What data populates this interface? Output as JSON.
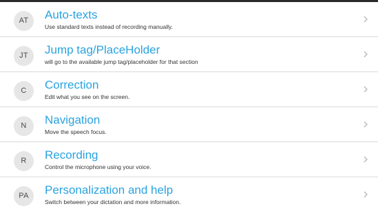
{
  "commands": {
    "items": [
      {
        "initials": "AT",
        "title": "Auto-texts",
        "subtitle": "Use standard texts instead of recording manually."
      },
      {
        "initials": "JT",
        "title": "Jump tag/PlaceHolder",
        "subtitle": "will go to the available jump tag/placeholder for that section"
      },
      {
        "initials": "C",
        "title": "Correction",
        "subtitle": "Edit what you see on the screen."
      },
      {
        "initials": "N",
        "title": "Navigation",
        "subtitle": "Move the speech focus."
      },
      {
        "initials": "R",
        "title": "Recording",
        "subtitle": "Control the microphone using your voice."
      },
      {
        "initials": "PA",
        "title": "Personalization and help",
        "subtitle": "Switch between your dictation and more information."
      }
    ]
  },
  "colors": {
    "title": "#29a3e0",
    "avatar_bg": "#e6e6e6",
    "divider": "#d9d9d9",
    "chevron": "#b5b5b5"
  },
  "icons": {
    "chevron": "chevron-right-icon"
  }
}
